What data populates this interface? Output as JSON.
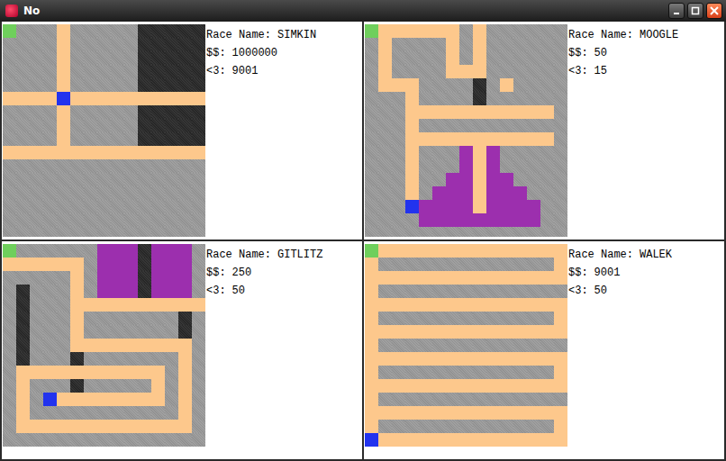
{
  "window": {
    "title": "No"
  },
  "labels": {
    "name": "Race Name:",
    "money": "$$:",
    "hearts": "<3:"
  },
  "terrain": [
    {
      "kind": "rock",
      "color": "#9a9a9a"
    },
    {
      "kind": "road",
      "color": "#fdc88c"
    },
    {
      "kind": "pit",
      "color": "#2b2b2b"
    },
    {
      "kind": "crystal",
      "color": "#9c2fae"
    },
    {
      "kind": "start",
      "color": "#6fcf5c"
    },
    {
      "kind": "player",
      "color": "#2233ee"
    }
  ],
  "races": [
    {
      "name": "SIMKIN",
      "money": "1000000",
      "hearts": "9001",
      "grid": [
        [
          4,
          0,
          0,
          0,
          1,
          0,
          0,
          0,
          0,
          0,
          2,
          2,
          2,
          2,
          2
        ],
        [
          0,
          0,
          0,
          0,
          1,
          0,
          0,
          0,
          0,
          0,
          2,
          2,
          2,
          2,
          2
        ],
        [
          0,
          0,
          0,
          0,
          1,
          0,
          0,
          0,
          0,
          0,
          2,
          2,
          2,
          2,
          2
        ],
        [
          0,
          0,
          0,
          0,
          1,
          0,
          0,
          0,
          0,
          0,
          2,
          2,
          2,
          2,
          2
        ],
        [
          0,
          0,
          0,
          0,
          1,
          0,
          0,
          0,
          0,
          0,
          2,
          2,
          2,
          2,
          2
        ],
        [
          1,
          1,
          1,
          1,
          5,
          1,
          1,
          1,
          1,
          1,
          1,
          1,
          1,
          1,
          1
        ],
        [
          0,
          0,
          0,
          0,
          1,
          0,
          0,
          0,
          0,
          0,
          2,
          2,
          2,
          2,
          2
        ],
        [
          0,
          0,
          0,
          0,
          1,
          0,
          0,
          0,
          0,
          0,
          2,
          2,
          2,
          2,
          2
        ],
        [
          0,
          0,
          0,
          0,
          1,
          0,
          0,
          0,
          0,
          0,
          2,
          2,
          2,
          2,
          2
        ],
        [
          1,
          1,
          1,
          1,
          1,
          1,
          1,
          1,
          1,
          1,
          1,
          1,
          1,
          1,
          1
        ],
        [
          0,
          0,
          0,
          0,
          0,
          0,
          0,
          0,
          0,
          0,
          0,
          0,
          0,
          0,
          0
        ],
        [
          0,
          0,
          0,
          0,
          0,
          0,
          0,
          0,
          0,
          0,
          0,
          0,
          0,
          0,
          0
        ],
        [
          0,
          0,
          0,
          0,
          0,
          0,
          0,
          0,
          0,
          0,
          0,
          0,
          0,
          0,
          0
        ],
        [
          0,
          0,
          0,
          0,
          0,
          0,
          0,
          0,
          0,
          0,
          0,
          0,
          0,
          0,
          0
        ],
        [
          0,
          0,
          0,
          0,
          0,
          0,
          0,
          0,
          0,
          0,
          0,
          0,
          0,
          0,
          0
        ],
        [
          0,
          0,
          0,
          0,
          0,
          0,
          0,
          0,
          0,
          0,
          0,
          0,
          0,
          0,
          0
        ]
      ]
    },
    {
      "name": "MOOGLE",
      "money": "50",
      "hearts": "15",
      "grid": [
        [
          4,
          1,
          1,
          1,
          1,
          1,
          1,
          0,
          1,
          0,
          0,
          0,
          0,
          0,
          0
        ],
        [
          0,
          1,
          0,
          0,
          0,
          0,
          1,
          0,
          1,
          0,
          0,
          0,
          0,
          0,
          0
        ],
        [
          0,
          1,
          0,
          0,
          0,
          0,
          1,
          0,
          1,
          0,
          0,
          0,
          0,
          0,
          0
        ],
        [
          0,
          1,
          0,
          0,
          0,
          0,
          1,
          1,
          1,
          0,
          0,
          0,
          0,
          0,
          0
        ],
        [
          0,
          1,
          1,
          1,
          0,
          0,
          0,
          0,
          2,
          0,
          1,
          0,
          0,
          0,
          0
        ],
        [
          0,
          0,
          0,
          1,
          0,
          0,
          0,
          0,
          2,
          0,
          0,
          0,
          0,
          0,
          0
        ],
        [
          0,
          0,
          0,
          1,
          1,
          1,
          1,
          1,
          1,
          1,
          1,
          1,
          1,
          1,
          0
        ],
        [
          0,
          0,
          0,
          1,
          0,
          0,
          0,
          0,
          0,
          0,
          0,
          0,
          0,
          0,
          0
        ],
        [
          0,
          0,
          0,
          1,
          1,
          1,
          1,
          1,
          1,
          1,
          1,
          1,
          1,
          1,
          0
        ],
        [
          0,
          0,
          0,
          1,
          0,
          0,
          0,
          3,
          1,
          3,
          0,
          0,
          0,
          0,
          0
        ],
        [
          0,
          0,
          0,
          1,
          0,
          0,
          0,
          3,
          1,
          3,
          0,
          0,
          0,
          0,
          0
        ],
        [
          0,
          0,
          0,
          1,
          0,
          0,
          3,
          3,
          1,
          3,
          3,
          0,
          0,
          0,
          0
        ],
        [
          0,
          0,
          0,
          1,
          0,
          3,
          3,
          3,
          1,
          3,
          3,
          3,
          0,
          0,
          0
        ],
        [
          0,
          0,
          0,
          5,
          3,
          3,
          3,
          3,
          1,
          3,
          3,
          3,
          3,
          0,
          0
        ],
        [
          0,
          0,
          0,
          0,
          3,
          3,
          3,
          3,
          3,
          3,
          3,
          3,
          3,
          0,
          0
        ],
        [
          0,
          0,
          0,
          0,
          0,
          0,
          0,
          0,
          0,
          0,
          0,
          0,
          0,
          0,
          0
        ]
      ]
    },
    {
      "name": "GITLITZ",
      "money": "250",
      "hearts": "50",
      "grid": [
        [
          4,
          0,
          0,
          0,
          0,
          0,
          0,
          3,
          3,
          3,
          2,
          3,
          3,
          3,
          0
        ],
        [
          1,
          1,
          1,
          1,
          1,
          1,
          0,
          3,
          3,
          3,
          2,
          3,
          3,
          3,
          0
        ],
        [
          0,
          0,
          0,
          0,
          0,
          1,
          0,
          3,
          3,
          3,
          2,
          3,
          3,
          3,
          0
        ],
        [
          0,
          2,
          0,
          0,
          0,
          1,
          0,
          3,
          3,
          3,
          2,
          3,
          3,
          3,
          0
        ],
        [
          0,
          2,
          0,
          0,
          0,
          1,
          1,
          1,
          1,
          1,
          1,
          1,
          1,
          1,
          1
        ],
        [
          0,
          2,
          0,
          0,
          0,
          1,
          0,
          0,
          0,
          0,
          0,
          0,
          0,
          2,
          0
        ],
        [
          0,
          2,
          0,
          0,
          0,
          1,
          0,
          0,
          0,
          0,
          0,
          0,
          0,
          2,
          0
        ],
        [
          0,
          2,
          0,
          0,
          0,
          1,
          1,
          1,
          1,
          1,
          1,
          1,
          1,
          1,
          0
        ],
        [
          0,
          2,
          0,
          0,
          0,
          2,
          0,
          0,
          0,
          0,
          0,
          0,
          0,
          1,
          0
        ],
        [
          0,
          1,
          1,
          1,
          1,
          1,
          1,
          1,
          1,
          1,
          1,
          1,
          0,
          1,
          0
        ],
        [
          0,
          1,
          0,
          0,
          0,
          2,
          0,
          0,
          0,
          0,
          0,
          1,
          0,
          1,
          0
        ],
        [
          0,
          1,
          0,
          5,
          1,
          1,
          1,
          1,
          1,
          1,
          1,
          1,
          0,
          1,
          0
        ],
        [
          0,
          1,
          0,
          0,
          0,
          0,
          0,
          0,
          0,
          0,
          0,
          0,
          0,
          1,
          0
        ],
        [
          0,
          1,
          1,
          1,
          1,
          1,
          1,
          1,
          1,
          1,
          1,
          1,
          1,
          1,
          0
        ],
        [
          0,
          0,
          0,
          0,
          0,
          0,
          0,
          0,
          0,
          0,
          0,
          0,
          0,
          0,
          0
        ]
      ]
    },
    {
      "name": "WALEK",
      "money": "9001",
      "hearts": "50",
      "grid": [
        [
          4,
          1,
          1,
          1,
          1,
          1,
          1,
          1,
          1,
          1,
          1,
          1,
          1,
          1,
          1
        ],
        [
          1,
          0,
          0,
          0,
          0,
          0,
          0,
          0,
          0,
          0,
          0,
          0,
          0,
          0,
          1
        ],
        [
          1,
          1,
          1,
          1,
          1,
          1,
          1,
          1,
          1,
          1,
          1,
          1,
          1,
          1,
          1
        ],
        [
          1,
          0,
          0,
          0,
          0,
          0,
          0,
          0,
          0,
          0,
          0,
          0,
          0,
          0,
          0
        ],
        [
          1,
          1,
          1,
          1,
          1,
          1,
          1,
          1,
          1,
          1,
          1,
          1,
          1,
          1,
          1
        ],
        [
          1,
          0,
          0,
          0,
          0,
          0,
          0,
          0,
          0,
          0,
          0,
          0,
          0,
          0,
          1
        ],
        [
          1,
          1,
          1,
          1,
          1,
          1,
          1,
          1,
          1,
          1,
          1,
          1,
          1,
          1,
          1
        ],
        [
          1,
          0,
          0,
          0,
          0,
          0,
          0,
          0,
          0,
          0,
          0,
          0,
          0,
          0,
          0
        ],
        [
          1,
          1,
          1,
          1,
          1,
          1,
          1,
          1,
          1,
          1,
          1,
          1,
          1,
          1,
          1
        ],
        [
          1,
          0,
          0,
          0,
          0,
          0,
          0,
          0,
          0,
          0,
          0,
          0,
          0,
          0,
          1
        ],
        [
          1,
          1,
          1,
          1,
          1,
          1,
          1,
          1,
          1,
          1,
          1,
          1,
          1,
          1,
          1
        ],
        [
          1,
          0,
          0,
          0,
          0,
          0,
          0,
          0,
          0,
          0,
          0,
          0,
          0,
          0,
          0
        ],
        [
          1,
          1,
          1,
          1,
          1,
          1,
          1,
          1,
          1,
          1,
          1,
          1,
          1,
          1,
          1
        ],
        [
          1,
          0,
          0,
          0,
          0,
          0,
          0,
          0,
          0,
          0,
          0,
          0,
          0,
          0,
          1
        ],
        [
          5,
          1,
          1,
          1,
          1,
          1,
          1,
          1,
          1,
          1,
          1,
          1,
          1,
          1,
          1
        ]
      ]
    }
  ]
}
